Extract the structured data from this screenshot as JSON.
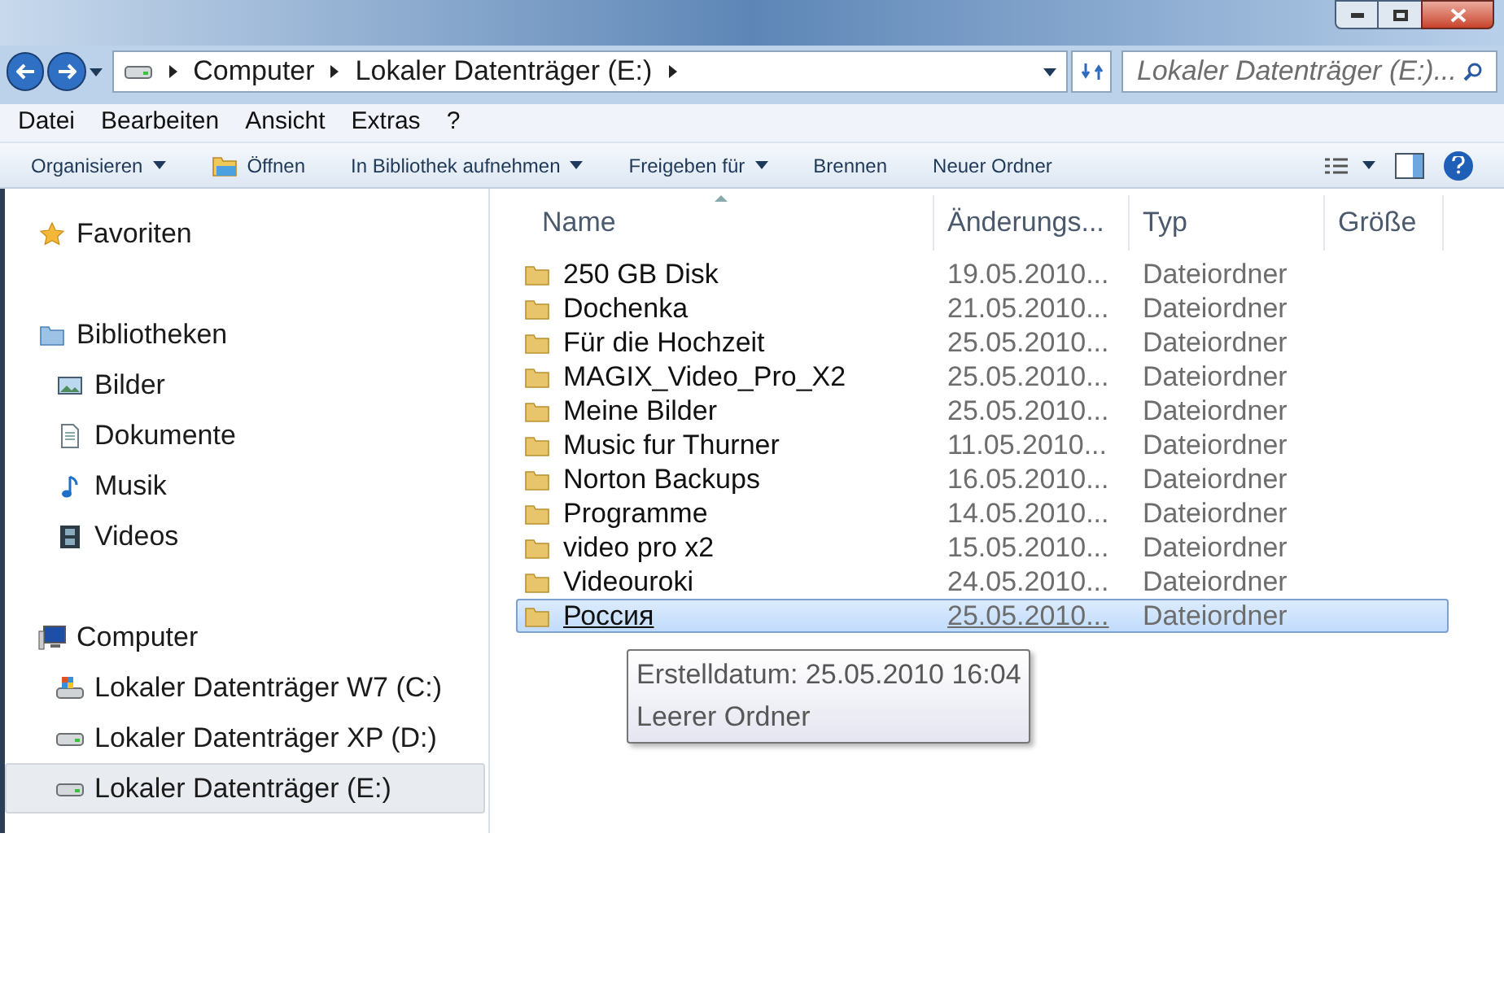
{
  "address_bar": {
    "crumbs": [
      "Computer",
      "Lokaler Datenträger (E:)"
    ]
  },
  "search": {
    "placeholder": "Lokaler Datenträger (E:)..."
  },
  "menu": [
    "Datei",
    "Bearbeiten",
    "Ansicht",
    "Extras",
    "?"
  ],
  "toolbar": [
    {
      "label": "Organisieren",
      "kind": "dropdown"
    },
    {
      "label": "Öffnen",
      "kind": "open"
    },
    {
      "label": "In Bibliothek aufnehmen",
      "kind": "dropdown"
    },
    {
      "label": "Freigeben für",
      "kind": "dropdown"
    },
    {
      "label": "Brennen",
      "kind": "plain"
    },
    {
      "label": "Neuer Ordner",
      "kind": "plain"
    }
  ],
  "sidebar": [
    {
      "label": "Favoriten",
      "kind": "star"
    },
    {
      "label": "Bibliotheken",
      "kind": "library",
      "children": [
        {
          "label": "Bilder",
          "kind": "pictures",
          "selected": false
        },
        {
          "label": "Dokumente",
          "kind": "documents",
          "selected": false
        },
        {
          "label": "Musik",
          "kind": "music",
          "selected": false
        },
        {
          "label": "Videos",
          "kind": "videos",
          "selected": false
        }
      ]
    },
    {
      "label": "Computer",
      "kind": "computer",
      "children": [
        {
          "label": "Lokaler Datenträger W7 (C:)",
          "kind": "system-drive",
          "selected": false
        },
        {
          "label": "Lokaler Datenträger XP (D:)",
          "kind": "drive",
          "selected": false
        },
        {
          "label": "Lokaler Datenträger (E:)",
          "kind": "drive",
          "selected": true
        }
      ]
    }
  ],
  "table": {
    "columns": [
      "Name",
      "Änderungs...",
      "Typ",
      "Größe"
    ],
    "rows": [
      {
        "name": "250 GB Disk",
        "date": "19.05.2010...",
        "type": "Dateiordner",
        "selected": false
      },
      {
        "name": "Dochenka",
        "date": "21.05.2010...",
        "type": "Dateiordner",
        "selected": false
      },
      {
        "name": "Für die Hochzeit",
        "date": "25.05.2010...",
        "type": "Dateiordner",
        "selected": false
      },
      {
        "name": "MAGIX_Video_Pro_X2",
        "date": "25.05.2010...",
        "type": "Dateiordner",
        "selected": false
      },
      {
        "name": "Meine Bilder",
        "date": "25.05.2010...",
        "type": "Dateiordner",
        "selected": false
      },
      {
        "name": "Music fur Thurner",
        "date": "11.05.2010...",
        "type": "Dateiordner",
        "selected": false
      },
      {
        "name": "Norton Backups",
        "date": "16.05.2010...",
        "type": "Dateiordner",
        "selected": false
      },
      {
        "name": "Programme",
        "date": "14.05.2010...",
        "type": "Dateiordner",
        "selected": false
      },
      {
        "name": "video pro x2",
        "date": "15.05.2010...",
        "type": "Dateiordner",
        "selected": false
      },
      {
        "name": "Videouroki",
        "date": "24.05.2010...",
        "type": "Dateiordner",
        "selected": false
      },
      {
        "name": "Россия",
        "date": "25.05.2010...",
        "type": "Dateiordner",
        "selected": true
      }
    ]
  },
  "tooltip": {
    "lines": [
      "Erstelldatum: 25.05.2010 16:04",
      "Leerer Ordner"
    ]
  }
}
